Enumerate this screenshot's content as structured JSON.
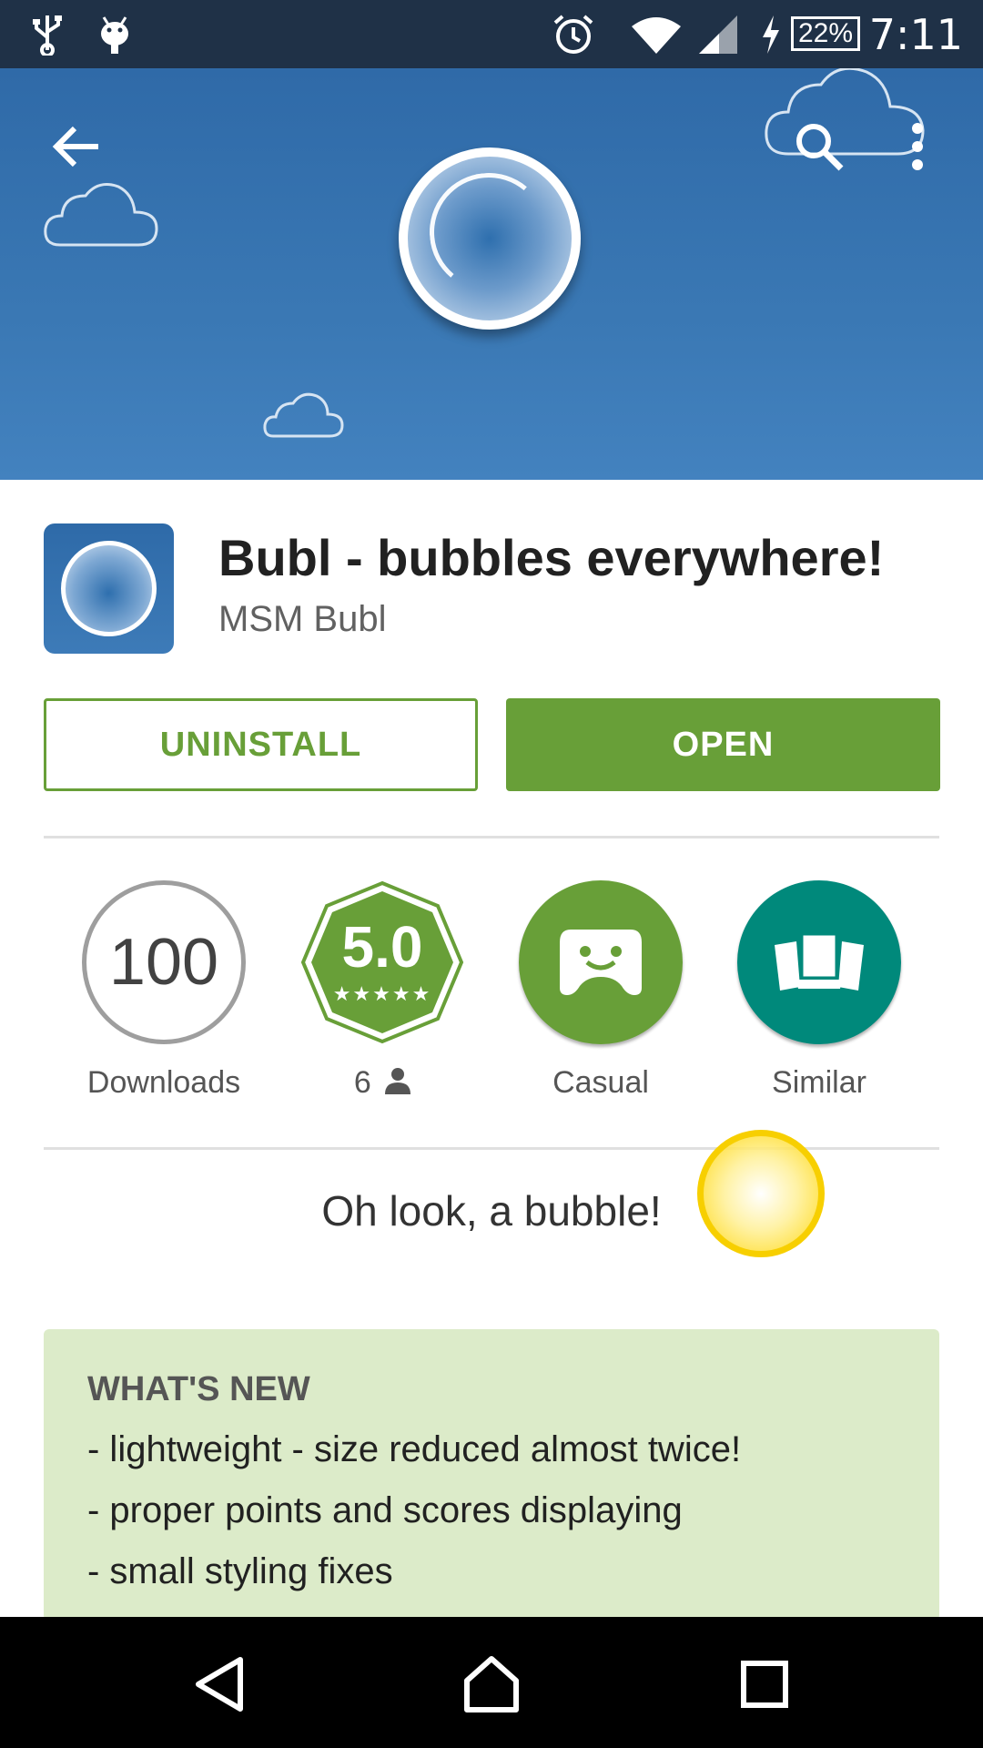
{
  "status_bar": {
    "battery": "22%",
    "time": "7:11",
    "icons": [
      "usb-icon",
      "android-debug-icon",
      "alarm-icon",
      "wifi-icon",
      "signal-icon",
      "charging-icon",
      "battery-icon"
    ]
  },
  "header": {
    "icons": [
      "back-arrow-icon",
      "search-icon",
      "more-vert-icon"
    ],
    "banner_color": "#3a78b4"
  },
  "app": {
    "title": "Bubl - bubbles everywhere!",
    "developer": "MSM Bubl"
  },
  "actions": {
    "uninstall_label": "UNINSTALL",
    "open_label": "OPEN",
    "accent": "#689f38"
  },
  "stats": {
    "downloads_value": "100",
    "downloads_label": "Downloads",
    "rating_value": "5.0",
    "rating_stars": 5,
    "rating_count": "6",
    "category_label": "Casual",
    "similar_label": "Similar"
  },
  "tagline": "Oh look, a bubble!",
  "whats_new": {
    "title": "WHAT'S NEW",
    "items": [
      "- lightweight - size reduced almost twice!",
      "- proper points and scores displaying",
      "- small styling fixes"
    ]
  },
  "nav": {
    "icons": [
      "nav-back-icon",
      "nav-home-icon",
      "nav-recents-icon"
    ]
  }
}
